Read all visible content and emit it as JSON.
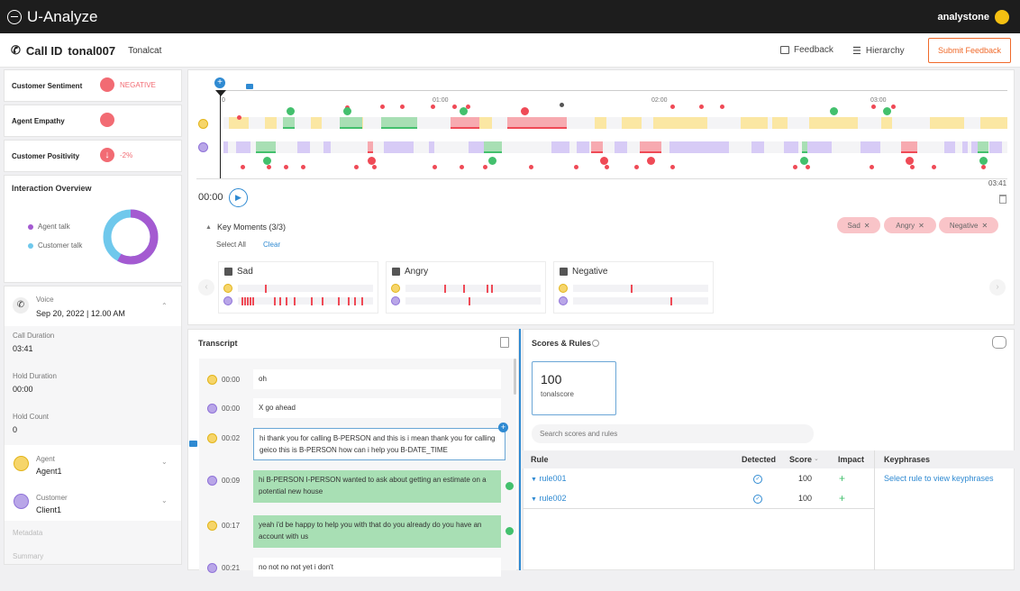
{
  "app": {
    "title": "U-Analyze",
    "user": "analystone"
  },
  "call": {
    "label": "Call ID",
    "id": "tonal007",
    "tenant": "Tonalcat"
  },
  "header": {
    "feedback": "Feedback",
    "hierarchy": "Hierarchy",
    "submit": "Submit Feedback"
  },
  "metrics": {
    "sentiment": {
      "label": "Customer Sentiment",
      "value": "NEGATIVE"
    },
    "empathy": {
      "label": "Agent Empathy"
    },
    "positivity": {
      "label": "Customer Positivity",
      "value": "-2%"
    }
  },
  "overview": {
    "title": "Interaction Overview",
    "agent": "Agent talk",
    "customer": "Customer talk",
    "agent_share": 0.58
  },
  "info": {
    "channel": "Voice",
    "date": "Sep 20, 2022 | 12.00 AM",
    "duration_label": "Call Duration",
    "duration": "03:41",
    "hold_label": "Hold Duration",
    "hold": "00:00",
    "holdcount_label": "Hold Count",
    "holdcount": "0",
    "agent_label": "Agent",
    "agent": "Agent1",
    "customer_label": "Customer",
    "customer": "Client1",
    "metadata": "Metadata",
    "summary": "Summary"
  },
  "timeline": {
    "ticks": [
      "0",
      "01:00",
      "02:00",
      "03:00"
    ],
    "current": "00:00",
    "end": "03:41"
  },
  "key_moments": {
    "title": "Key Moments (3/3)",
    "select_all": "Select All",
    "clear": "Clear",
    "pills": [
      "Sad",
      "Angry",
      "Negative"
    ],
    "cards": [
      "Sad",
      "Angry",
      "Negative"
    ]
  },
  "transcript": {
    "title": "Transcript",
    "rows": [
      {
        "time": "00:00",
        "text": "oh",
        "speaker": "agent"
      },
      {
        "time": "00:00",
        "text": "X go ahead",
        "speaker": "customer"
      },
      {
        "time": "00:02",
        "text": "hi thank you for calling B-PERSON and this is i mean thank you for calling geico this is B-PERSON how can i help you B-DATE_TIME",
        "speaker": "agent"
      },
      {
        "time": "00:09",
        "text": "hi B-PERSON I-PERSON wanted to ask about getting an estimate on a potential new house",
        "speaker": "customer"
      },
      {
        "time": "00:17",
        "text": "yeah i'd be happy to help you with that do you already do you have an account with us",
        "speaker": "agent"
      },
      {
        "time": "00:21",
        "text": "no not no not yet i don't",
        "speaker": "customer"
      }
    ]
  },
  "scores": {
    "title": "Scores & Rules",
    "score": "100",
    "score_label": "tonalscore",
    "search_placeholder": "Search scores and rules",
    "headers": {
      "rule": "Rule",
      "detected": "Detected",
      "score": "Score",
      "impact": "Impact",
      "keyphrases": "Keyphrases"
    },
    "rows": [
      {
        "rule": "rule001",
        "score": "100",
        "impact": "+"
      },
      {
        "rule": "rule002",
        "score": "100",
        "impact": "+"
      }
    ],
    "keyphrase_hint": "Select rule to view keyphrases"
  },
  "colors": {
    "accent": "#f06a2a",
    "link": "#2f8ad2",
    "negative": "#ef4a56",
    "positive": "#43c06d",
    "agent": "#f6d76a",
    "customer": "#c7b5f2"
  }
}
